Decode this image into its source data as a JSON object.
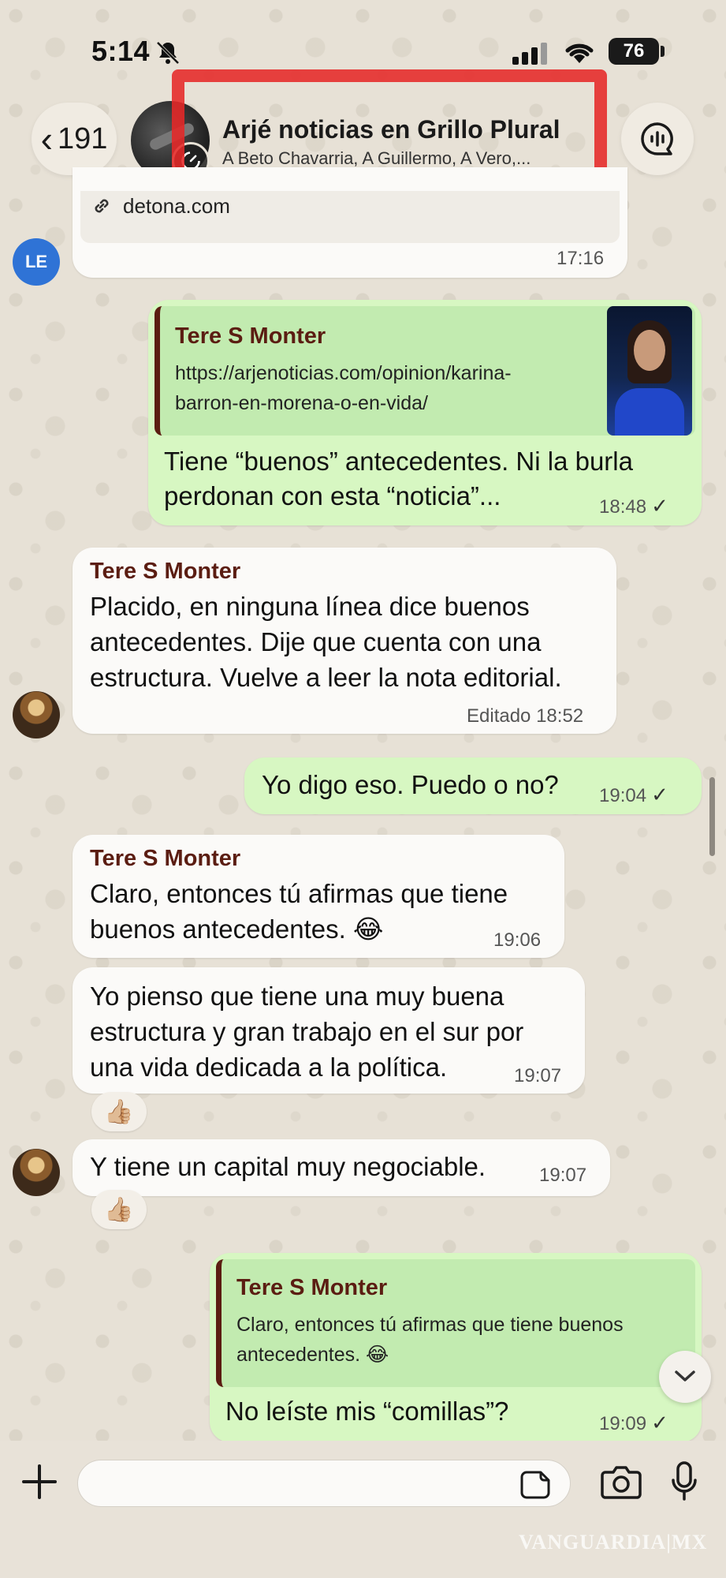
{
  "status": {
    "time": "5:14",
    "battery": "76"
  },
  "header": {
    "back_count": "191",
    "title": "Arjé noticias en Grillo Plural",
    "subtitle": "A Beto Chavarria, A Guillermo, A Vero,..."
  },
  "messages": {
    "m0": {
      "link": "detona.com",
      "time": "17:16",
      "avatar_initials": "LE"
    },
    "m1": {
      "quote_name": "Tere S Monter",
      "quote_url_line1": "https://arjenoticias.com/opinion/karina-",
      "quote_url_line2": "barron-en-morena-o-en-vida/",
      "text_line1": "Tiene “buenos” antecedentes. Ni la burla",
      "text_line2": "perdonan con esta “noticia”...",
      "time": "18:48"
    },
    "m2": {
      "sender": "Tere S Monter",
      "line1": "Placido, en ninguna línea dice buenos",
      "line2": "antecedentes. Dije que cuenta con una",
      "line3": "estructura. Vuelve a leer la nota editorial.",
      "edited": "Editado",
      "time": "18:52"
    },
    "m3": {
      "text": "Yo digo eso. Puedo o no?",
      "time": "19:04"
    },
    "m4": {
      "sender": "Tere S Monter",
      "line1": "Claro, entonces tú afirmas que tiene",
      "line2": "buenos antecedentes. 😂",
      "time": "19:06"
    },
    "m5": {
      "line1": "Yo pienso que tiene una muy buena",
      "line2": "estructura y gran trabajo en el sur por",
      "line3": "una vida dedicada a la política.",
      "time": "19:07",
      "reaction": "👍🏼"
    },
    "m6": {
      "text": "Y tiene un capital muy negociable.",
      "time": "19:07",
      "reaction": "👍🏼"
    },
    "m7": {
      "quote_name": "Tere S Monter",
      "quote_line1": "Claro, entonces tú afirmas que tiene buenos",
      "quote_line2": "antecedentes. 😂",
      "text": "No leíste mis “comillas”?",
      "time": "19:09"
    }
  },
  "check_glyph": "✓",
  "watermark": "VANGUARDIA|MX",
  "colors": {
    "outgoing": "#d7f7c2",
    "incoming": "#fbfaf8",
    "sender": "#5b1d12",
    "annotation": "#e62828"
  },
  "icons": [
    "bell-slash-icon",
    "signal-icon",
    "wifi-icon",
    "chevron-left-icon",
    "timer-icon",
    "voice-chat-icon",
    "link-icon",
    "plus-icon",
    "sticker-icon",
    "camera-icon",
    "mic-icon",
    "chevron-down-icon"
  ]
}
